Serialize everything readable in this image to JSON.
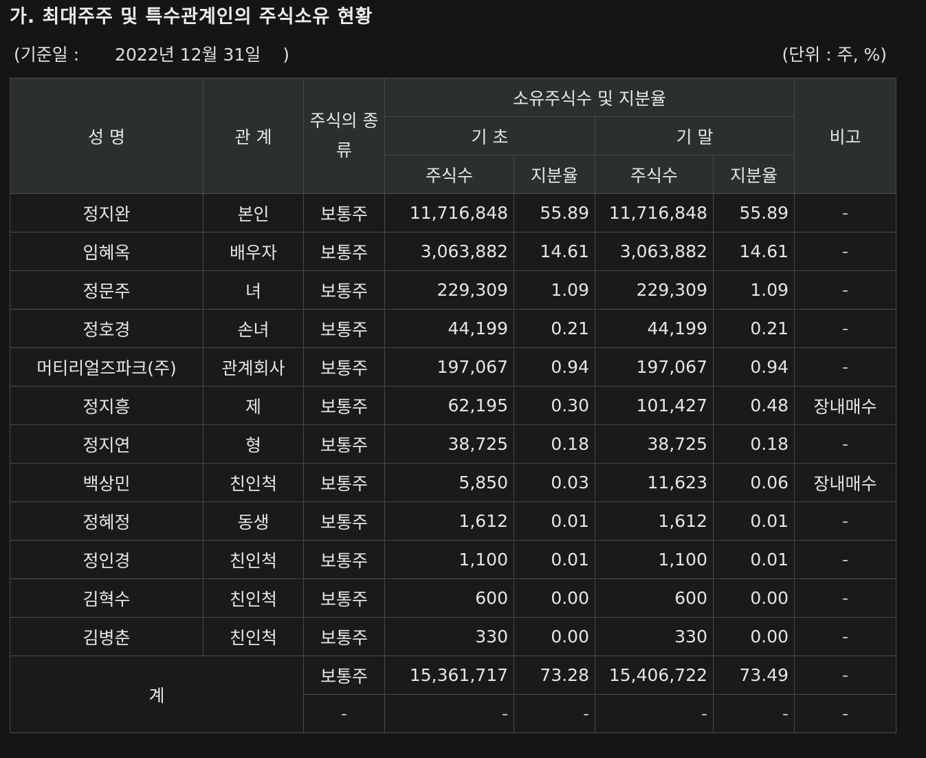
{
  "title": "가. 최대주주 및 특수관계인의 주식소유 현황",
  "base_date": {
    "open": "(기준일 :",
    "date": "2022년 12월 31일",
    "close": ")"
  },
  "unit": "(단위 : 주, %)",
  "header": {
    "name": "성 명",
    "relation": "관 계",
    "stock_type": "주식의 종류",
    "holdings": "소유주식수 및 지분율",
    "begin": "기 초",
    "end": "기 말",
    "shares": "주식수",
    "ratio": "지분율",
    "note": "비고"
  },
  "rows": [
    {
      "name": "정지완",
      "relation": "본인",
      "type": "보통주",
      "begin_shares": "11,716,848",
      "begin_ratio": "55.89",
      "end_shares": "11,716,848",
      "end_ratio": "55.89",
      "note": "-"
    },
    {
      "name": "임혜옥",
      "relation": "배우자",
      "type": "보통주",
      "begin_shares": "3,063,882",
      "begin_ratio": "14.61",
      "end_shares": "3,063,882",
      "end_ratio": "14.61",
      "note": "-"
    },
    {
      "name": "정문주",
      "relation": "녀",
      "type": "보통주",
      "begin_shares": "229,309",
      "begin_ratio": "1.09",
      "end_shares": "229,309",
      "end_ratio": "1.09",
      "note": "-"
    },
    {
      "name": "정호경",
      "relation": "손녀",
      "type": "보통주",
      "begin_shares": "44,199",
      "begin_ratio": "0.21",
      "end_shares": "44,199",
      "end_ratio": "0.21",
      "note": "-"
    },
    {
      "name": "머티리얼즈파크(주)",
      "relation": "관계회사",
      "type": "보통주",
      "begin_shares": "197,067",
      "begin_ratio": "0.94",
      "end_shares": "197,067",
      "end_ratio": "0.94",
      "note": "-"
    },
    {
      "name": "정지흥",
      "relation": "제",
      "type": "보통주",
      "begin_shares": "62,195",
      "begin_ratio": "0.30",
      "end_shares": "101,427",
      "end_ratio": "0.48",
      "note": "장내매수"
    },
    {
      "name": "정지연",
      "relation": "형",
      "type": "보통주",
      "begin_shares": "38,725",
      "begin_ratio": "0.18",
      "end_shares": "38,725",
      "end_ratio": "0.18",
      "note": "-"
    },
    {
      "name": "백상민",
      "relation": "친인척",
      "type": "보통주",
      "begin_shares": "5,850",
      "begin_ratio": "0.03",
      "end_shares": "11,623",
      "end_ratio": "0.06",
      "note": "장내매수"
    },
    {
      "name": "정혜정",
      "relation": "동생",
      "type": "보통주",
      "begin_shares": "1,612",
      "begin_ratio": "0.01",
      "end_shares": "1,612",
      "end_ratio": "0.01",
      "note": "-"
    },
    {
      "name": "정인경",
      "relation": "친인척",
      "type": "보통주",
      "begin_shares": "1,100",
      "begin_ratio": "0.01",
      "end_shares": "1,100",
      "end_ratio": "0.01",
      "note": "-"
    },
    {
      "name": "김혁수",
      "relation": "친인척",
      "type": "보통주",
      "begin_shares": "600",
      "begin_ratio": "0.00",
      "end_shares": "600",
      "end_ratio": "0.00",
      "note": "-"
    },
    {
      "name": "김병춘",
      "relation": "친인척",
      "type": "보통주",
      "begin_shares": "330",
      "begin_ratio": "0.00",
      "end_shares": "330",
      "end_ratio": "0.00",
      "note": "-"
    }
  ],
  "total": {
    "label": "계",
    "common": {
      "type": "보통주",
      "begin_shares": "15,361,717",
      "begin_ratio": "73.28",
      "end_shares": "15,406,722",
      "end_ratio": "73.49",
      "note": "-"
    },
    "other": {
      "type": "-",
      "begin_shares": "-",
      "begin_ratio": "-",
      "end_shares": "-",
      "end_ratio": "-",
      "note": "-"
    }
  }
}
